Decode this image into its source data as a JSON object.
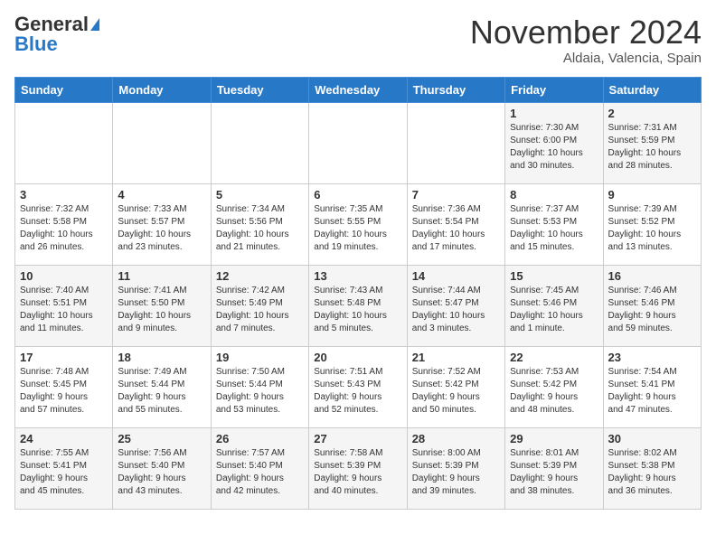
{
  "header": {
    "logo_general": "General",
    "logo_blue": "Blue",
    "month_title": "November 2024",
    "location": "Aldaia, Valencia, Spain"
  },
  "weekdays": [
    "Sunday",
    "Monday",
    "Tuesday",
    "Wednesday",
    "Thursday",
    "Friday",
    "Saturday"
  ],
  "weeks": [
    [
      {
        "day": "",
        "info": ""
      },
      {
        "day": "",
        "info": ""
      },
      {
        "day": "",
        "info": ""
      },
      {
        "day": "",
        "info": ""
      },
      {
        "day": "",
        "info": ""
      },
      {
        "day": "1",
        "info": "Sunrise: 7:30 AM\nSunset: 6:00 PM\nDaylight: 10 hours\nand 30 minutes."
      },
      {
        "day": "2",
        "info": "Sunrise: 7:31 AM\nSunset: 5:59 PM\nDaylight: 10 hours\nand 28 minutes."
      }
    ],
    [
      {
        "day": "3",
        "info": "Sunrise: 7:32 AM\nSunset: 5:58 PM\nDaylight: 10 hours\nand 26 minutes."
      },
      {
        "day": "4",
        "info": "Sunrise: 7:33 AM\nSunset: 5:57 PM\nDaylight: 10 hours\nand 23 minutes."
      },
      {
        "day": "5",
        "info": "Sunrise: 7:34 AM\nSunset: 5:56 PM\nDaylight: 10 hours\nand 21 minutes."
      },
      {
        "day": "6",
        "info": "Sunrise: 7:35 AM\nSunset: 5:55 PM\nDaylight: 10 hours\nand 19 minutes."
      },
      {
        "day": "7",
        "info": "Sunrise: 7:36 AM\nSunset: 5:54 PM\nDaylight: 10 hours\nand 17 minutes."
      },
      {
        "day": "8",
        "info": "Sunrise: 7:37 AM\nSunset: 5:53 PM\nDaylight: 10 hours\nand 15 minutes."
      },
      {
        "day": "9",
        "info": "Sunrise: 7:39 AM\nSunset: 5:52 PM\nDaylight: 10 hours\nand 13 minutes."
      }
    ],
    [
      {
        "day": "10",
        "info": "Sunrise: 7:40 AM\nSunset: 5:51 PM\nDaylight: 10 hours\nand 11 minutes."
      },
      {
        "day": "11",
        "info": "Sunrise: 7:41 AM\nSunset: 5:50 PM\nDaylight: 10 hours\nand 9 minutes."
      },
      {
        "day": "12",
        "info": "Sunrise: 7:42 AM\nSunset: 5:49 PM\nDaylight: 10 hours\nand 7 minutes."
      },
      {
        "day": "13",
        "info": "Sunrise: 7:43 AM\nSunset: 5:48 PM\nDaylight: 10 hours\nand 5 minutes."
      },
      {
        "day": "14",
        "info": "Sunrise: 7:44 AM\nSunset: 5:47 PM\nDaylight: 10 hours\nand 3 minutes."
      },
      {
        "day": "15",
        "info": "Sunrise: 7:45 AM\nSunset: 5:46 PM\nDaylight: 10 hours\nand 1 minute."
      },
      {
        "day": "16",
        "info": "Sunrise: 7:46 AM\nSunset: 5:46 PM\nDaylight: 9 hours\nand 59 minutes."
      }
    ],
    [
      {
        "day": "17",
        "info": "Sunrise: 7:48 AM\nSunset: 5:45 PM\nDaylight: 9 hours\nand 57 minutes."
      },
      {
        "day": "18",
        "info": "Sunrise: 7:49 AM\nSunset: 5:44 PM\nDaylight: 9 hours\nand 55 minutes."
      },
      {
        "day": "19",
        "info": "Sunrise: 7:50 AM\nSunset: 5:44 PM\nDaylight: 9 hours\nand 53 minutes."
      },
      {
        "day": "20",
        "info": "Sunrise: 7:51 AM\nSunset: 5:43 PM\nDaylight: 9 hours\nand 52 minutes."
      },
      {
        "day": "21",
        "info": "Sunrise: 7:52 AM\nSunset: 5:42 PM\nDaylight: 9 hours\nand 50 minutes."
      },
      {
        "day": "22",
        "info": "Sunrise: 7:53 AM\nSunset: 5:42 PM\nDaylight: 9 hours\nand 48 minutes."
      },
      {
        "day": "23",
        "info": "Sunrise: 7:54 AM\nSunset: 5:41 PM\nDaylight: 9 hours\nand 47 minutes."
      }
    ],
    [
      {
        "day": "24",
        "info": "Sunrise: 7:55 AM\nSunset: 5:41 PM\nDaylight: 9 hours\nand 45 minutes."
      },
      {
        "day": "25",
        "info": "Sunrise: 7:56 AM\nSunset: 5:40 PM\nDaylight: 9 hours\nand 43 minutes."
      },
      {
        "day": "26",
        "info": "Sunrise: 7:57 AM\nSunset: 5:40 PM\nDaylight: 9 hours\nand 42 minutes."
      },
      {
        "day": "27",
        "info": "Sunrise: 7:58 AM\nSunset: 5:39 PM\nDaylight: 9 hours\nand 40 minutes."
      },
      {
        "day": "28",
        "info": "Sunrise: 8:00 AM\nSunset: 5:39 PM\nDaylight: 9 hours\nand 39 minutes."
      },
      {
        "day": "29",
        "info": "Sunrise: 8:01 AM\nSunset: 5:39 PM\nDaylight: 9 hours\nand 38 minutes."
      },
      {
        "day": "30",
        "info": "Sunrise: 8:02 AM\nSunset: 5:38 PM\nDaylight: 9 hours\nand 36 minutes."
      }
    ]
  ]
}
